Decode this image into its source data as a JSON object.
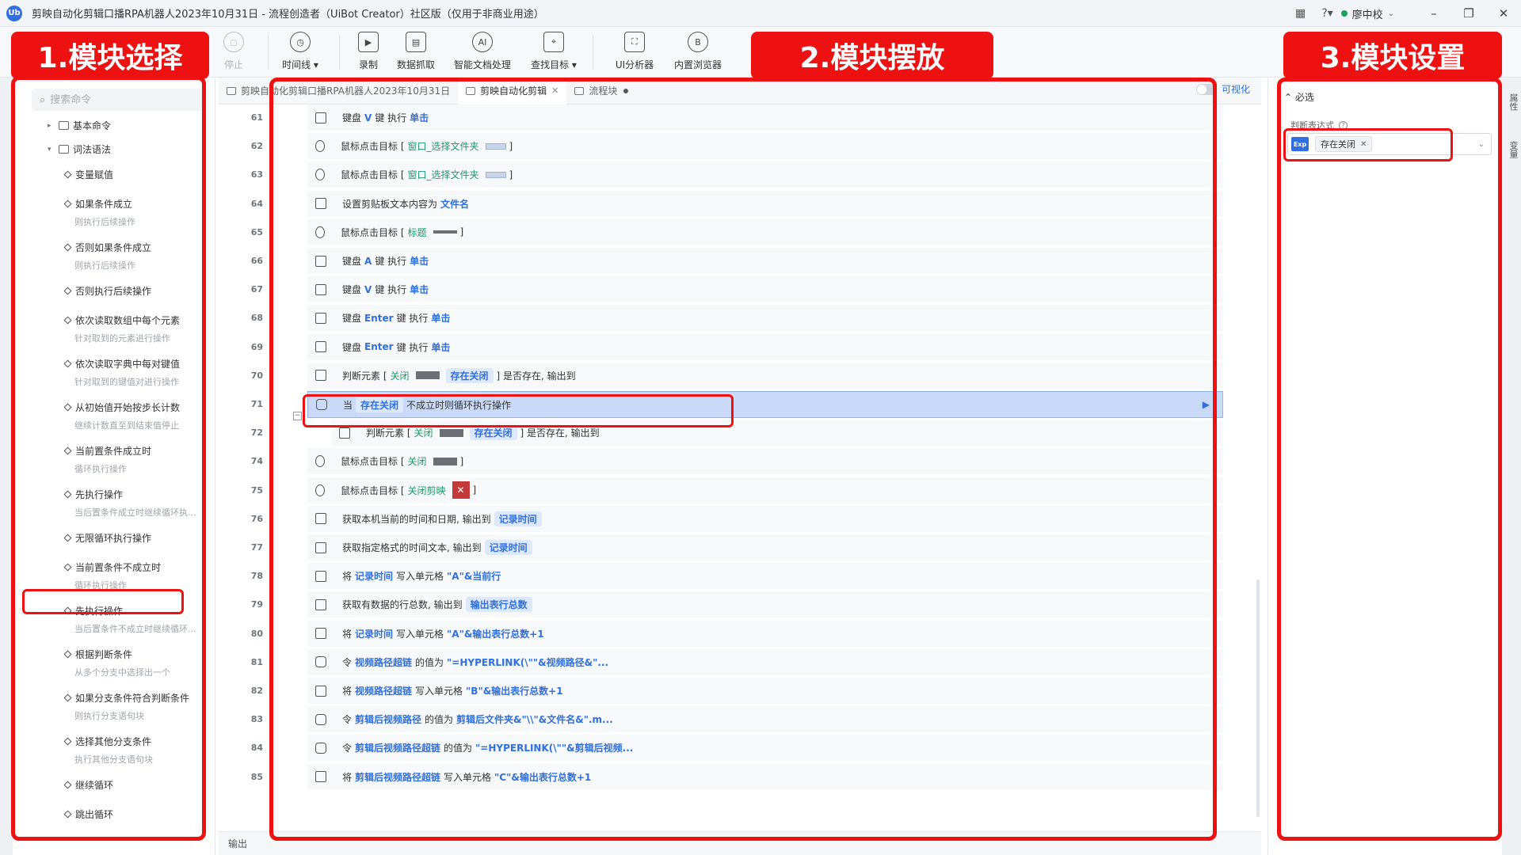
{
  "window": {
    "logo_text": "Ub",
    "title": "剪映自动化剪辑口播RPA机器人2023年10月31日 - 流程创造者（UiBot Creator）社区版（仅用于非商业用途）",
    "user_name": "廖中校",
    "status_color": "#1aa35f"
  },
  "toolbar": {
    "stop": "停止",
    "timeline": "时间线",
    "record": "录制",
    "data_scrape": "数据抓取",
    "smart_doc": "智能文档处理",
    "find_target": "查找目标",
    "ui_analyzer": "UI分析器",
    "browser": "内置浏览器"
  },
  "left_panel": {
    "search_placeholder": "搜索命令",
    "node_basic": "基本命令",
    "node_syntax": "词法语法",
    "commands": [
      {
        "name": "变量赋值",
        "desc": ""
      },
      {
        "name": "如果条件成立",
        "desc": "则执行后续操作"
      },
      {
        "name": "否则如果条件成立",
        "desc": "则执行后续操作"
      },
      {
        "name": "否则执行后续操作",
        "desc": ""
      },
      {
        "name": "依次读取数组中每个元素",
        "desc": "针对取到的元素进行操作"
      },
      {
        "name": "依次读取字典中每对键值",
        "desc": "针对取到的键值对进行操作"
      },
      {
        "name": "从初始值开始按步长计数",
        "desc": "继续计数直至到结束值停止"
      },
      {
        "name": "当前置条件成立时",
        "desc": "循环执行操作"
      },
      {
        "name": "先执行操作",
        "desc": "当后置条件成立时继续循环执..."
      },
      {
        "name": "无限循环执行操作",
        "desc": ""
      },
      {
        "name": "当前置条件不成立时",
        "desc": "循环执行操作"
      },
      {
        "name": "先执行操作",
        "desc": "当后置条件不成立时继续循环..."
      },
      {
        "name": "根据判断条件",
        "desc": "从多个分支中选择出一个"
      },
      {
        "name": "如果分支条件符合判断条件",
        "desc": "则执行分支语句块"
      },
      {
        "name": "选择其他分支条件",
        "desc": "执行其他分支语句块"
      },
      {
        "name": "继续循环",
        "desc": ""
      },
      {
        "name": "跳出循环",
        "desc": ""
      }
    ]
  },
  "tabs": {
    "tab1": "剪映自动化剪辑口播RPA机器人2023年10月31日",
    "tab2": "剪映自动化剪辑",
    "tab3": "流程块",
    "visual_toggle": "可视化"
  },
  "editor": {
    "rows": [
      {
        "num": "61",
        "p1": "键盘",
        "k1": "V",
        "p2": "键 执行",
        "k2": "单击"
      },
      {
        "num": "62",
        "p1": "鼠标点击目标 [",
        "t1": "窗口_选择文件夹",
        "p2": "]"
      },
      {
        "num": "63",
        "p1": "鼠标点击目标 [",
        "t1": "窗口_选择文件夹",
        "p2": "]"
      },
      {
        "num": "64",
        "p1": "设置剪贴板文本内容为",
        "k1": "文件名"
      },
      {
        "num": "65",
        "p1": "鼠标点击目标 [",
        "t1": "标题",
        "p2": "]"
      },
      {
        "num": "66",
        "p1": "键盘",
        "k1": "A",
        "p2": "键 执行",
        "k2": "单击"
      },
      {
        "num": "67",
        "p1": "键盘",
        "k1": "V",
        "p2": "键 执行",
        "k2": "单击"
      },
      {
        "num": "68",
        "p1": "键盘",
        "k1": "Enter",
        "p2": "键 执行",
        "k2": "单击"
      },
      {
        "num": "69",
        "p1": "键盘",
        "k1": "Enter",
        "p2": "键 执行",
        "k2": "单击"
      },
      {
        "num": "70",
        "p1": "判断元素 [",
        "t1": "关闭",
        "p2": "] 是否存在, 输出到",
        "v1": "存在关闭"
      },
      {
        "num": "71",
        "p1": "当",
        "v1": "存在关闭",
        "p2": "不成立时则循环执行操作"
      },
      {
        "num": "72",
        "p1": "判断元素 [",
        "t1": "关闭",
        "p2": "] 是否存在, 输出到",
        "v1": "存在关闭"
      },
      {
        "num": "74",
        "p1": "鼠标点击目标 [",
        "t1": "关闭",
        "p2": "]"
      },
      {
        "num": "75",
        "p1": "鼠标点击目标 [",
        "t1": "关闭剪映",
        "p2": "]"
      },
      {
        "num": "76",
        "p1": "获取本机当前的时间和日期, 输出到",
        "v1": "记录时间"
      },
      {
        "num": "77",
        "p1": "获取指定格式的时间文本, 输出到",
        "v1": "记录时间"
      },
      {
        "num": "78",
        "p1": "将",
        "k1": "记录时间",
        "p2": "写入单元格",
        "k2": "\"A\"&当前行"
      },
      {
        "num": "79",
        "p1": "获取有数据的行总数, 输出到",
        "v1": "输出表行总数"
      },
      {
        "num": "80",
        "p1": "将",
        "k1": "记录时间",
        "p2": "写入单元格",
        "k2": "\"A\"&输出表行总数+1"
      },
      {
        "num": "81",
        "p1": "令",
        "k1": "视频路径超链",
        "p2": "的值为",
        "k2": "\"=HYPERLINK(\\\"\"&视频路径&\"..."
      },
      {
        "num": "82",
        "p1": "将",
        "k1": "视频路径超链",
        "p2": "写入单元格",
        "k2": "\"B\"&输出表行总数+1"
      },
      {
        "num": "83",
        "p1": "令",
        "k1": "剪辑后视频路径",
        "p2": "的值为",
        "k2": "剪辑后文件夹&\"\\\\\"&文件名&\".m..."
      },
      {
        "num": "84",
        "p1": "令",
        "k1": "剪辑后视频路径超链",
        "p2": "的值为",
        "k2": "\"=HYPERLINK(\\\"\"&剪辑后视频..."
      },
      {
        "num": "85",
        "p1": "将",
        "k1": "剪辑后视频路径超链",
        "p2": "写入单元格",
        "k2": "\"C\"&输出表行总数+1"
      }
    ],
    "thumb_close": "关闭",
    "output_label": "输出"
  },
  "right_panel": {
    "required_header": "必选",
    "expr_label": "判断表达式",
    "exp_badge": "Exp",
    "expr_chip": "存在关闭",
    "side_tab_1": "属性",
    "side_tab_2": "变量"
  },
  "annotations": {
    "label1": "1.模块选择",
    "label2": "2.模块摆放",
    "label3": "3.模块设置",
    "color": "#ee1111"
  }
}
